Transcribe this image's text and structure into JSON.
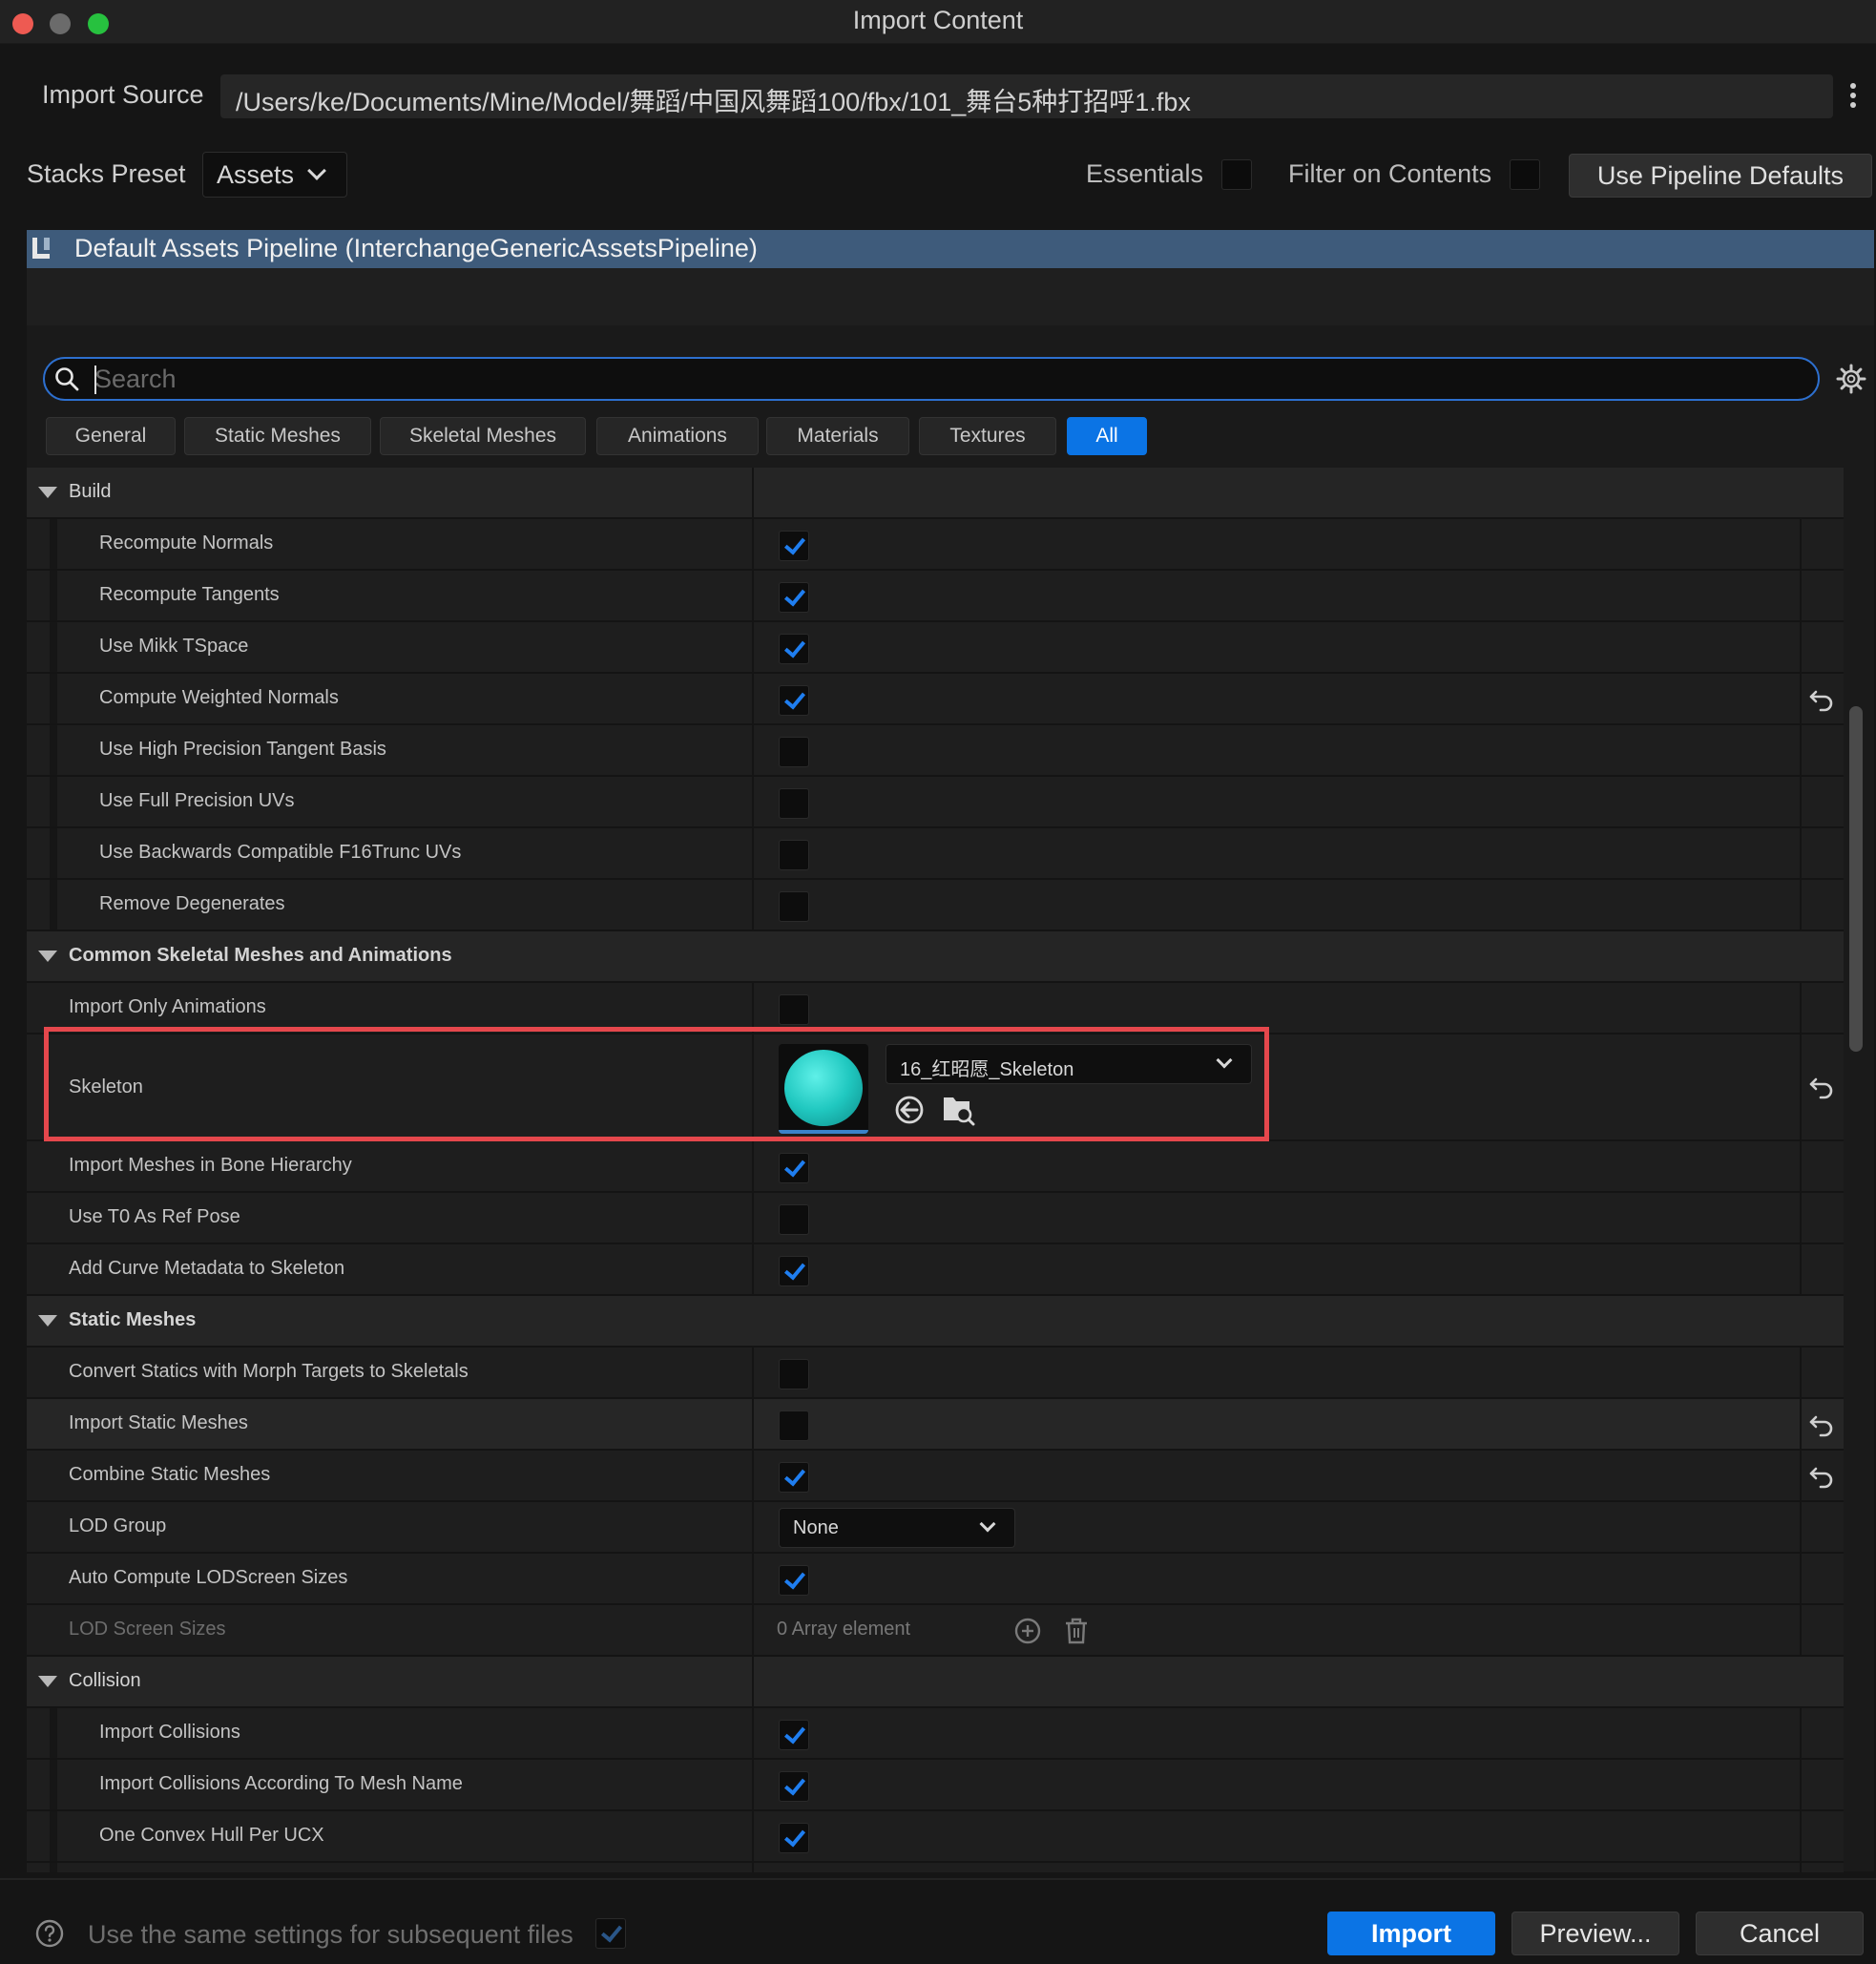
{
  "window": {
    "title": "Import Content"
  },
  "import_source": {
    "label": "Import Source",
    "path": "/Users/ke/Documents/Mine/Model/舞蹈/中国风舞蹈100/fbx/101_舞台5种打招呼1.fbx"
  },
  "stacks": {
    "label": "Stacks Preset",
    "preset": "Assets",
    "essentials_label": "Essentials",
    "essentials_checked": false,
    "filter_label": "Filter on Contents",
    "filter_checked": false,
    "use_defaults_label": "Use Pipeline Defaults"
  },
  "pipeline": {
    "name": "Default Assets Pipeline (InterchangeGenericAssetsPipeline)"
  },
  "search": {
    "placeholder": "Search"
  },
  "tabs": [
    {
      "label": "General",
      "active": false
    },
    {
      "label": "Static Meshes",
      "active": false
    },
    {
      "label": "Skeletal Meshes",
      "active": false
    },
    {
      "label": "Animations",
      "active": false
    },
    {
      "label": "Materials",
      "active": false
    },
    {
      "label": "Textures",
      "active": false
    },
    {
      "label": "All",
      "active": true
    }
  ],
  "sections": {
    "build": {
      "title": "Build",
      "props": [
        {
          "label": "Recompute Normals",
          "checked": true
        },
        {
          "label": "Recompute Tangents",
          "checked": true
        },
        {
          "label": "Use Mikk TSpace",
          "checked": true
        },
        {
          "label": "Compute Weighted Normals",
          "checked": true
        },
        {
          "label": "Use High Precision Tangent Basis",
          "checked": false
        },
        {
          "label": "Use Full Precision UVs",
          "checked": false
        },
        {
          "label": "Use Backwards Compatible F16Trunc UVs",
          "checked": false
        },
        {
          "label": "Remove Degenerates",
          "checked": false
        }
      ]
    },
    "common": {
      "title": "Common Skeletal Meshes and Animations",
      "import_only_animations": {
        "label": "Import Only Animations",
        "checked": false
      },
      "skeleton": {
        "label": "Skeleton",
        "value": "16_红昭愿_Skeleton",
        "thumbnail_color": "#20c8c0"
      },
      "props": [
        {
          "label": "Import Meshes in Bone Hierarchy",
          "checked": true
        },
        {
          "label": "Use T0 As Ref Pose",
          "checked": false
        },
        {
          "label": "Add Curve Metadata to Skeleton",
          "checked": true
        }
      ]
    },
    "static_meshes": {
      "title": "Static Meshes",
      "props": [
        {
          "label": "Convert Statics with Morph Targets to Skeletals",
          "checked": false
        },
        {
          "label": "Import Static Meshes",
          "checked": false
        },
        {
          "label": "Combine Static Meshes",
          "checked": true
        }
      ],
      "lod_group": {
        "label": "LOD Group",
        "value": "None"
      },
      "auto_compute": {
        "label": "Auto Compute LODScreen Sizes",
        "checked": true
      },
      "lod_screen_sizes": {
        "label": "LOD Screen Sizes",
        "value": "0 Array element"
      }
    },
    "collision": {
      "title": "Collision",
      "props": [
        {
          "label": "Import Collisions",
          "checked": true
        },
        {
          "label": "Import Collisions According To Mesh Name",
          "checked": true
        },
        {
          "label": "One Convex Hull Per UCX",
          "checked": true
        }
      ]
    }
  },
  "footer": {
    "same_settings_label": "Use the same settings for subsequent files",
    "same_settings_checked": true,
    "import_label": "Import",
    "preview_label": "Preview...",
    "cancel_label": "Cancel"
  },
  "colors": {
    "accent": "#0b74e5",
    "highlight_box": "#e5474c",
    "check": "#1f7ef0",
    "pipeline_bar": "#3e5b7b"
  }
}
